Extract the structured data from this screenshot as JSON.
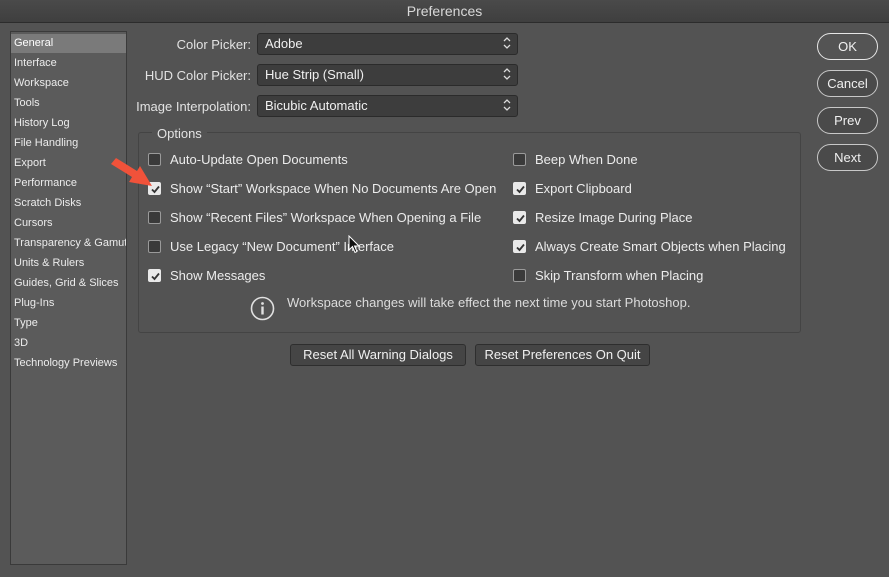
{
  "window": {
    "title": "Preferences"
  },
  "sidebar": {
    "items": [
      {
        "label": "General",
        "selected": true
      },
      {
        "label": "Interface"
      },
      {
        "label": "Workspace"
      },
      {
        "label": "Tools"
      },
      {
        "label": "History Log"
      },
      {
        "label": "File Handling"
      },
      {
        "label": "Export"
      },
      {
        "label": "Performance"
      },
      {
        "label": "Scratch Disks"
      },
      {
        "label": "Cursors"
      },
      {
        "label": "Transparency & Gamut"
      },
      {
        "label": "Units & Rulers"
      },
      {
        "label": "Guides, Grid & Slices"
      },
      {
        "label": "Plug-Ins"
      },
      {
        "label": "Type"
      },
      {
        "label": "3D"
      },
      {
        "label": "Technology Previews"
      }
    ]
  },
  "fields": {
    "color_picker": {
      "label": "Color Picker:",
      "value": "Adobe"
    },
    "hud_color_picker": {
      "label": "HUD Color Picker:",
      "value": "Hue Strip (Small)"
    },
    "image_interpolation": {
      "label": "Image Interpolation:",
      "value": "Bicubic Automatic"
    }
  },
  "options": {
    "title": "Options",
    "left": [
      {
        "label": "Auto-Update Open Documents",
        "checked": false
      },
      {
        "label": "Show “Start” Workspace When No Documents Are Open",
        "checked": true
      },
      {
        "label": "Show “Recent Files” Workspace When Opening a File",
        "checked": false
      },
      {
        "label": "Use Legacy “New Document” Interface",
        "checked": false
      },
      {
        "label": "Show Messages",
        "checked": true
      }
    ],
    "right": [
      {
        "label": "Beep When Done",
        "checked": false
      },
      {
        "label": "Export Clipboard",
        "checked": true
      },
      {
        "label": "Resize Image During Place",
        "checked": true
      },
      {
        "label": "Always Create Smart Objects when Placing",
        "checked": true
      },
      {
        "label": "Skip Transform when Placing",
        "checked": false
      }
    ],
    "info": "Workspace changes will take effect the next time you start Photoshop."
  },
  "buttons": {
    "reset_warnings": "Reset All Warning Dialogs",
    "reset_prefs": "Reset Preferences On Quit",
    "ok": "OK",
    "cancel": "Cancel",
    "prev": "Prev",
    "next": "Next"
  },
  "colors": {
    "background": "#535353",
    "annotation_arrow": "#f0523a"
  }
}
